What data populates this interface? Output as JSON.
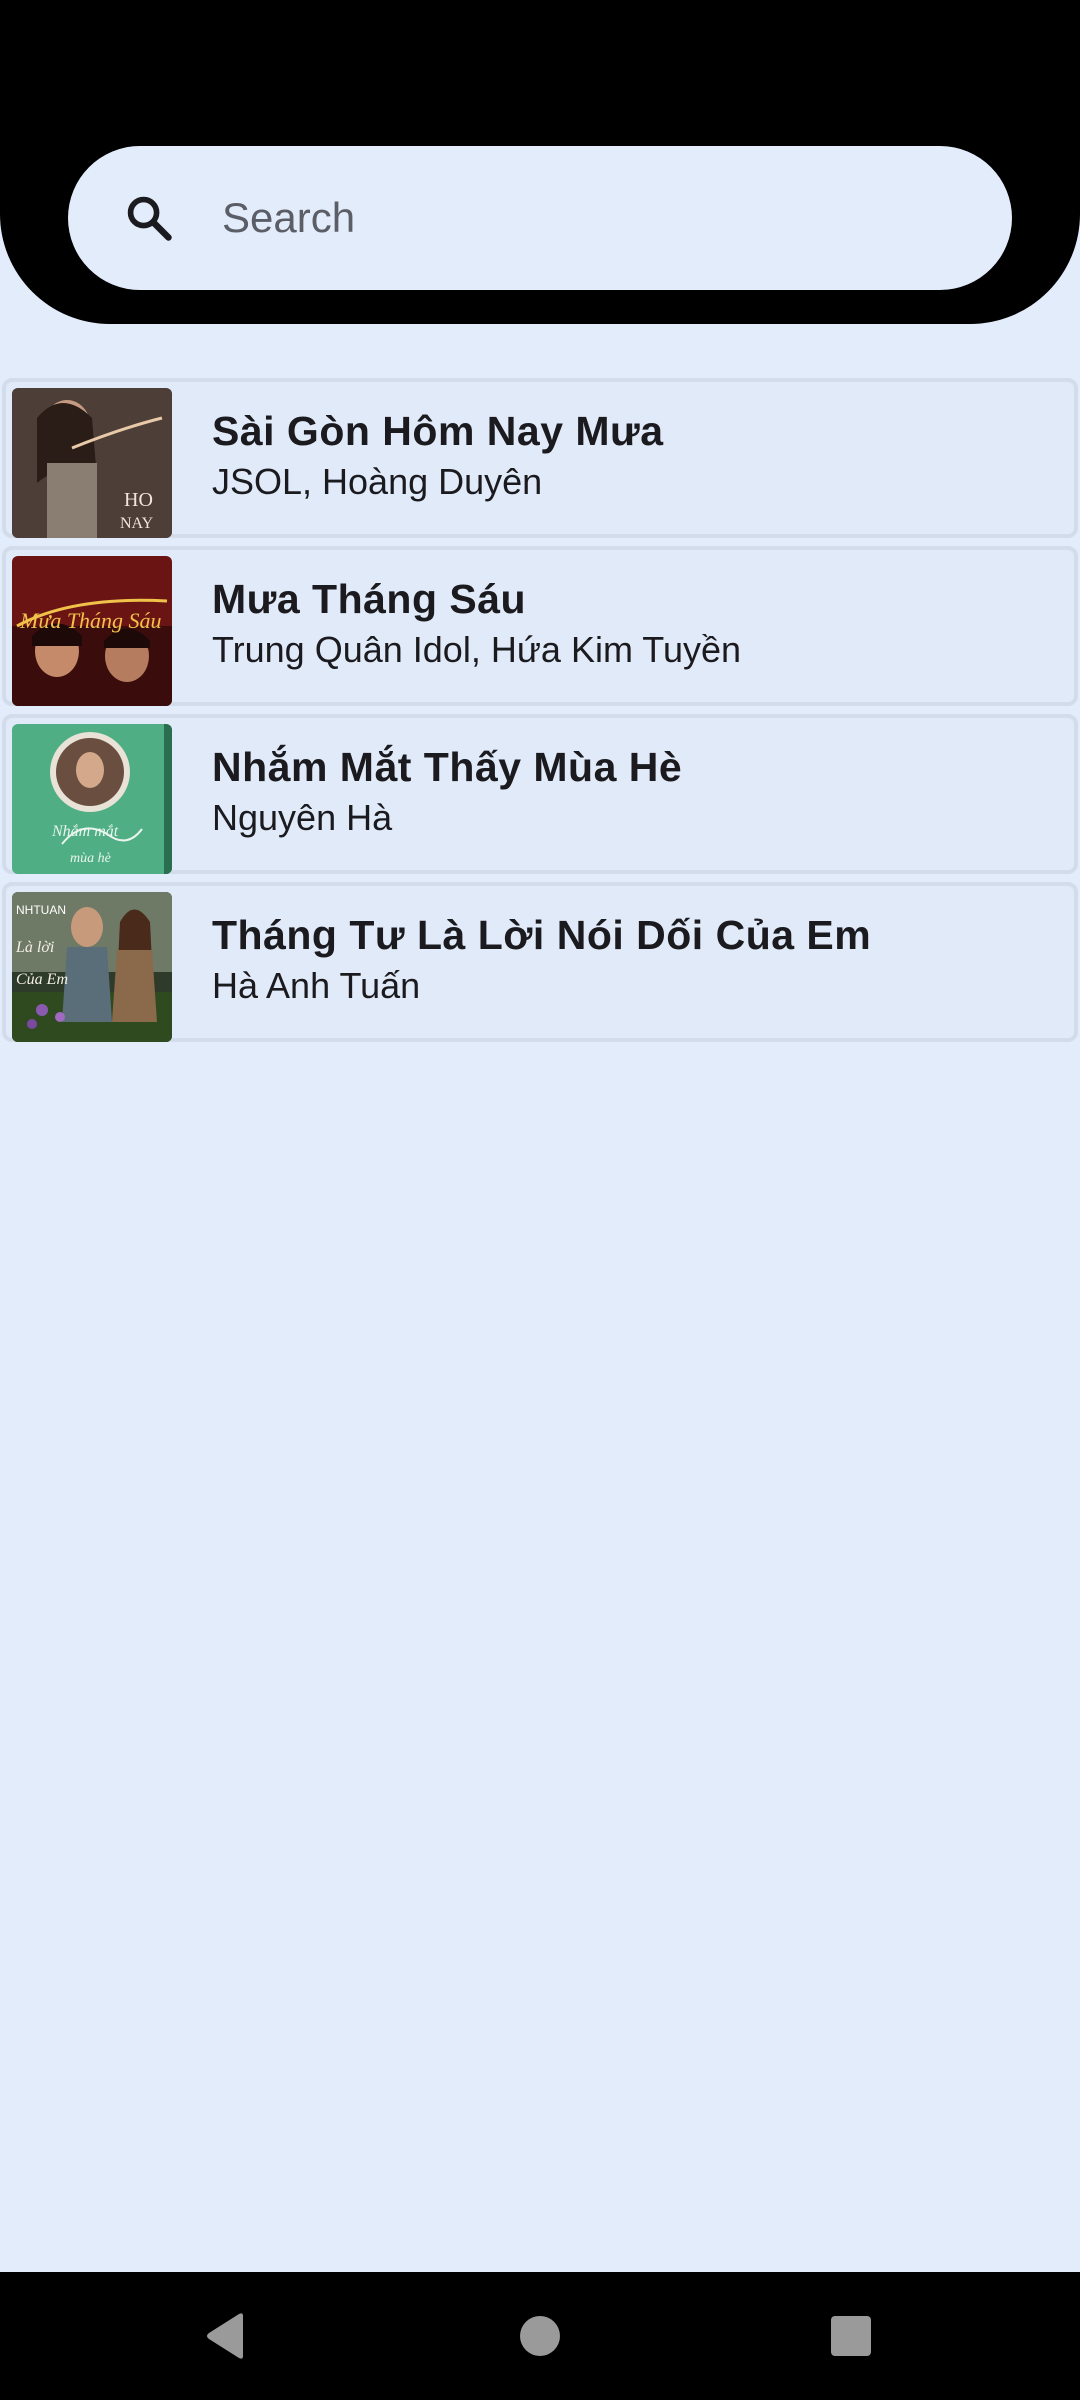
{
  "search": {
    "placeholder": "Search",
    "icon": "search-icon"
  },
  "songs": [
    {
      "title": "Sài Gòn Hôm Nay Mưa",
      "artist": "JSOL, Hoàng Duyên",
      "thumb": "album-art-1"
    },
    {
      "title": "Mưa Tháng Sáu",
      "artist": "Trung Quân Idol, Hứa Kim Tuyền",
      "thumb": "album-art-2"
    },
    {
      "title": "Nhắm Mắt Thấy Mùa Hè",
      "artist": "Nguyên Hà",
      "thumb": "album-art-3"
    },
    {
      "title": "Tháng Tư Là Lời Nói Dối Của Em",
      "artist": "Hà Anh Tuấn",
      "thumb": "album-art-4"
    }
  ],
  "nav": {
    "back": "back-icon",
    "home": "home-icon",
    "recents": "recents-icon"
  },
  "colors": {
    "background": "#e3ecfb",
    "header": "#000000",
    "text": "#1b1b1f"
  }
}
